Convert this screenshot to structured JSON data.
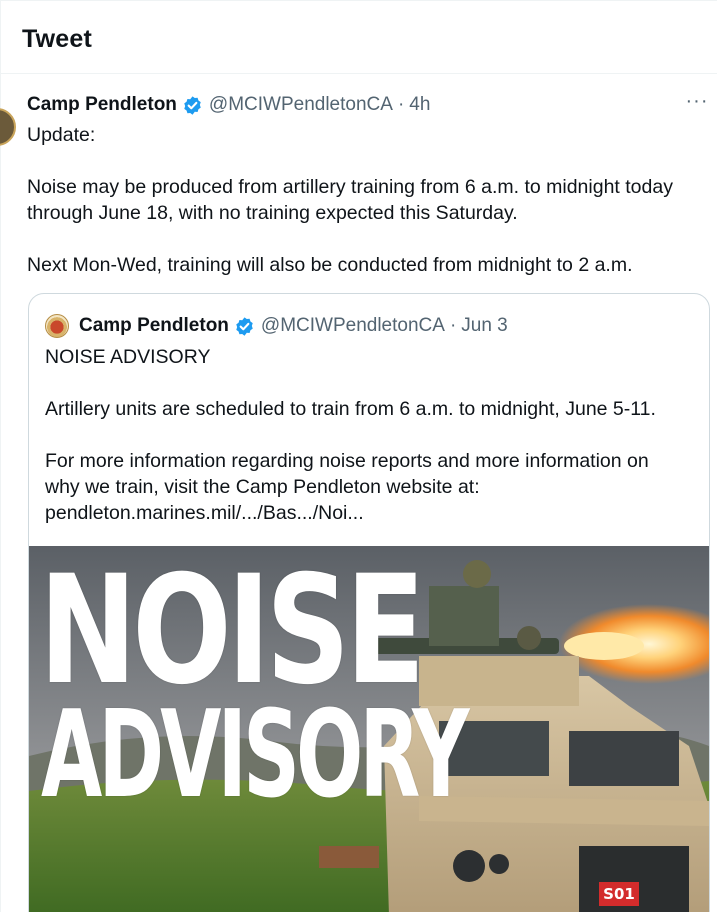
{
  "header": {
    "title": "Tweet"
  },
  "tweet": {
    "author_name": "Camp Pendleton",
    "handle": "@MCIWPendletonCA",
    "separator": "·",
    "time": "4h",
    "more_label": "···",
    "lines": [
      "Update:",
      "Noise may be produced from artillery training from 6 a.m. to midnight today",
      "through June 18, with no training expected this Saturday.",
      "Next Mon-Wed, training will also be conducted from midnight to 2 a.m."
    ]
  },
  "quoted": {
    "author_name": "Camp Pendleton",
    "handle": "@MCIWPendletonCA",
    "separator": "·",
    "time": "Jun 3",
    "lines": [
      "NOISE ADVISORY",
      "Artillery units are scheduled to train from 6 a.m. to midnight, June 5-11.",
      "For more information regarding noise reports and more information on",
      "why we train, visit the Camp Pendleton website at:",
      "pendleton.marines.mil/.../Bas.../Noi..."
    ],
    "image": {
      "headline_1": "NOISE",
      "headline_2": "ADVISORY",
      "plate_text": "S01"
    }
  },
  "colors": {
    "verified": "#1d9bf0",
    "muted_text": "#536471",
    "border": "#cfd9de"
  },
  "icons": {
    "verified": "verified-badge-icon",
    "more": "more-options-icon"
  }
}
